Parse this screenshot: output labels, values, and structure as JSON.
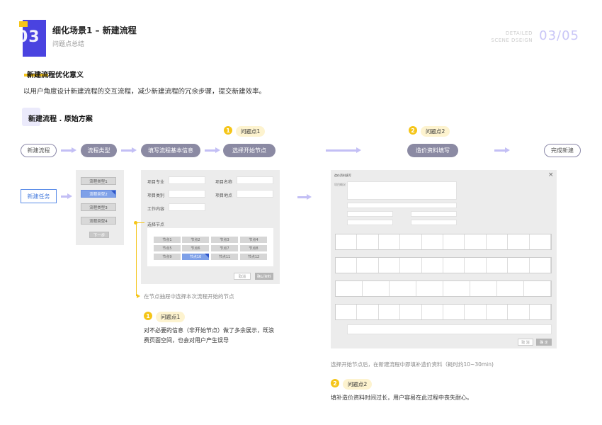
{
  "header": {
    "number": "03",
    "title": "细化场景1 – 新建流程",
    "subtitle": "问题点总结",
    "top_right_line1": "DETAILED",
    "top_right_line2": "SCENE DSEIGN",
    "page_indicator": "03/05"
  },
  "section1": {
    "title": "新建流程优化意义",
    "desc": "以用户角度设计新建流程的交互流程，减少新建流程的冗余步骤，提交新建效率。"
  },
  "section2": {
    "title": "新建流程 . 原始方案"
  },
  "flow": {
    "steps": [
      "新建流程",
      "流程类型",
      "填写流程基本信息",
      "选择开始节点",
      "造价资料填写",
      "完成新建"
    ],
    "problem1_num": "1",
    "problem1_label": "问题点1",
    "problem2_num": "2",
    "problem2_label": "问题点2"
  },
  "new_task": "新建任务",
  "types_panel": {
    "items": [
      "流程类型1",
      "流程类型2",
      "流程类型3",
      "流程类型4"
    ],
    "next": "下一步"
  },
  "form_panel": {
    "label_major": "项目专业",
    "label_name": "项目名称",
    "label_type": "项目类别",
    "label_location": "项目地点",
    "label_content": "工作内容",
    "select_node": "选择节点",
    "nodes": [
      "节点1",
      "节点2",
      "节点3",
      "节点4",
      "节点5",
      "节点6",
      "节点7",
      "节点8",
      "节点9",
      "节点10",
      "节点11",
      "节点12"
    ],
    "cancel": "取消",
    "confirm": "确认资料"
  },
  "callout1": "在节点抽屉中选择本次流程开始的节点",
  "problem1_desc_line1": "对不必要的信息（非开始节点）做了多余展示，既浪",
  "problem1_desc_line2": "费页面空间，也会对用户产生误导",
  "cost_dialog": {
    "title": "造价资料填写",
    "close": "×",
    "left_label": "项目概况",
    "cancel": "取 消",
    "confirm": "确 定"
  },
  "callout2": "选择开始节点后，在新建流程中即填补造价资料（耗时约10~30min)",
  "problem2_desc": "填补造价资料时间过长，用户容易在此过程中丧失耐心。",
  "colors": {
    "accent": "#4a43e0",
    "yellow": "#f5c518",
    "pill": "#8b8aa3",
    "arrow": "#c3bff5"
  }
}
